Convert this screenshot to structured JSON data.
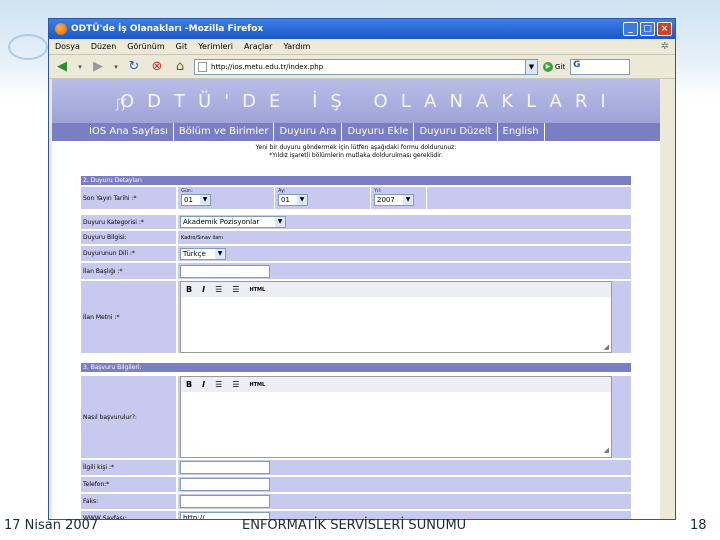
{
  "window": {
    "title": "ODTÜ'de İş Olanakları -Mozilla Firefox",
    "menu": [
      "Dosya",
      "Düzen",
      "Görünüm",
      "Git",
      "Yerimleri",
      "Araçlar",
      "Yardım"
    ],
    "url": "http://ios.metu.edu.tr/index.php",
    "go_label": "Git",
    "search_label": "G"
  },
  "site": {
    "banner": "ODTÜ'DE İŞ OLANAKLARI",
    "tabs": [
      "İOS Ana Sayfası",
      "Bölüm ve Birimler",
      "Duyuru Ara",
      "Duyuru Ekle",
      "Duyuru Düzelt",
      "English"
    ],
    "note_line1": "Yeni bir duyuru göndermek için lütfen aşağıdaki formu doldurunuz:",
    "note_line2": "*Yıldız işaretli bölümlerin mutlaka doldurulması gereklidir."
  },
  "form": {
    "section2_title": "2. Duyuru Detayları",
    "section3_title": "3. Başvuru Bilgileri:",
    "son_yayin_label": "Son Yayın Tarihi :*",
    "gun_caption": "Gün:",
    "ay_caption": "Ay:",
    "yil_caption": "Yıl:",
    "gun_value": "01",
    "ay_value": "01",
    "yil_value": "2007",
    "kategori_label": "Duyuru Kategorisi :*",
    "kategori_value": "Akademik Pozisyonlar",
    "bilgisi_label": "Duyuru Bilgisi:",
    "bilgisi_value": "Kadro/Sınav ilanı",
    "dili_label": "Duyurunun Dili :*",
    "dili_value": "Türkçe",
    "baslik_label": "İlan Başlığı :*",
    "metni_label": "İlan Metni :*",
    "basvuru_label": "Nasıl başvurulur?:",
    "ilgili_label": "İlgili kişi :*",
    "telefon_label": "Telefon:*",
    "faks_label": "Faks:",
    "www_label": "WWW Sayfası:",
    "www_value": "http://",
    "rte_bold": "B",
    "rte_italic": "I",
    "rte_html": "HTML"
  },
  "slide": {
    "date": "17 Nisan 2007",
    "title": "ENFORMATİK SERVİSLERİ SUNUMU",
    "page": "18"
  }
}
